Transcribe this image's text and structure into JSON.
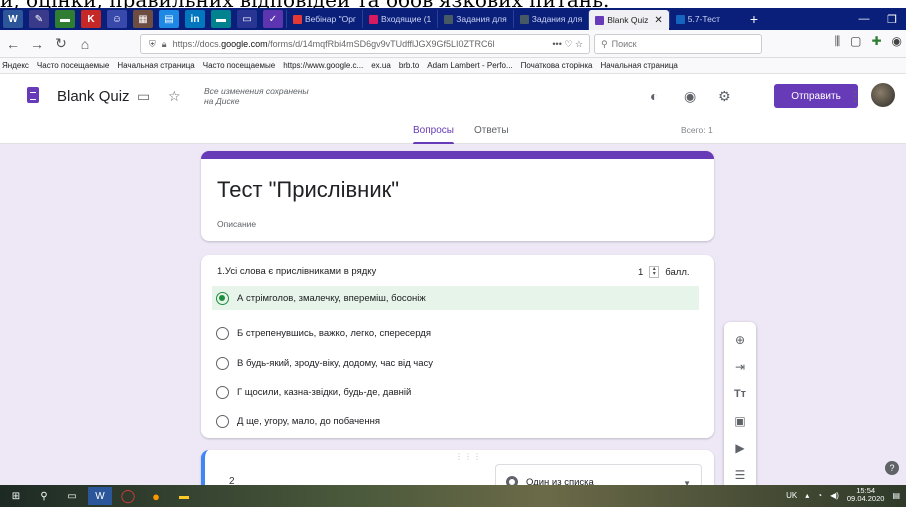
{
  "top_text": "и, оцінки, правильних відповідей та обов'язкових питань.",
  "browser": {
    "tabs": [
      {
        "label": "Вебінар \"Орг",
        "color": "#e53935"
      },
      {
        "label": "Входящие (1",
        "color": "#d81b60"
      },
      {
        "label": "Задания для",
        "color": "#455a64"
      },
      {
        "label": "Задания для",
        "color": "#455a64"
      },
      {
        "label": "Blank Quiz",
        "color": "#673ab7",
        "active": true
      },
      {
        "label": "5.7-Тест",
        "color": "#1565c0"
      }
    ],
    "new_tab": "+",
    "url_prefix": "https://docs.",
    "url_domain": "google.com",
    "url_rest": "/forms/d/14mqfRbi4mSD6gv9vTUdfflJGX9Gf5LI0ZTRC6l",
    "search_placeholder": "Поиск",
    "bookmarks": [
      "Яндекс",
      "Часто посещаемые",
      "Начальная страница",
      "Часто посещаемые",
      "https://www.google.c...",
      "ex.ua",
      "brb.to",
      "Adam Lambert - Perfo...",
      "Початкова сторінка",
      "Начальная страница"
    ]
  },
  "app": {
    "title": "Blank Quiz",
    "saved_line1": "Все изменения сохранены",
    "saved_line2": "на Диске",
    "send_label": "Отправить",
    "tab_questions": "Вопросы",
    "tab_answers": "Ответы",
    "total": "Всего: 1"
  },
  "form": {
    "title": "Тест \"Прислівник\"",
    "description": "Описание"
  },
  "question": {
    "title": "1.Усі слова є прислівниками в рядку",
    "points": "1",
    "points_unit": "балл.",
    "options": [
      {
        "label": "А стрімголов, змалечку, впереміш, босоніж",
        "selected": true
      },
      {
        "label": "Б стрепенувшись, важко, легко, спересердя",
        "selected": false
      },
      {
        "label": "В будь-який, зроду-віку, додому, час від часу",
        "selected": false
      },
      {
        "label": "Г щосили, казна-звідки, будь-де, давній",
        "selected": false
      },
      {
        "label": "Д ще, угору, мало, до побачення",
        "selected": false
      }
    ]
  },
  "new_question": {
    "text": "2",
    "type_label": "Один из списка"
  },
  "sidebar_icons": [
    "add-question-icon",
    "import-icon",
    "title-icon",
    "image-icon",
    "video-icon",
    "section-icon"
  ],
  "taskbar": {
    "lang": "UK",
    "time": "15:54",
    "date": "09.04.2020"
  },
  "colors": {
    "accent": "#673ab7",
    "correct": "#1e8e3e",
    "tabbar": "#0a1f7a"
  }
}
